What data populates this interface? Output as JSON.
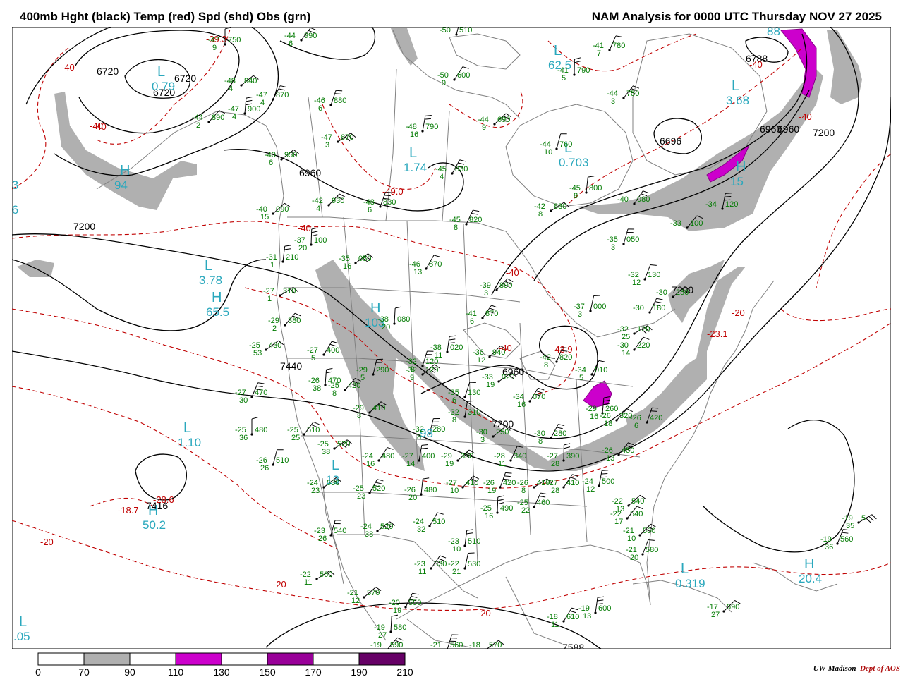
{
  "header": {
    "left_title": "400mb Hght (black) Temp (red) Spd (shd) Obs (grn)",
    "right_title": "NAM Analysis for 0000 UTC Thursday  NOV 27 2025"
  },
  "colors": {
    "height": "#000000",
    "temp": "#c00000",
    "obs": "#007a00",
    "center": "#2aa8bd",
    "border": "#808080",
    "shade_70": "#b0b0b0",
    "shade_110": "#cc00cc",
    "shade_150": "#990099",
    "shade_190": "#660066"
  },
  "colorbar": {
    "ticks": [
      "0",
      "70",
      "90",
      "110",
      "130",
      "150",
      "170",
      "190",
      "210"
    ],
    "fills": [
      "#ffffff",
      "#b0b0b0",
      "#ffffff",
      "#cc00cc",
      "#ffffff",
      "#990099",
      "#ffffff",
      "#660066"
    ]
  },
  "credit": {
    "org": "UW-Madison",
    "dept": "Dept of AOS"
  },
  "height_labels": [
    "6720",
    "6720",
    "6720",
    "6960",
    "6960",
    "6960",
    "6960",
    "7200",
    "7200",
    "7200",
    "7440",
    "7200",
    "7416",
    "6788",
    "6696",
    "7588"
  ],
  "temp_labels": [
    "-40",
    "-40",
    "-40",
    "-40",
    "-40",
    "-40",
    "-40",
    "-40",
    "-20",
    "-20",
    "-20",
    "-20",
    "-39.3",
    "-49.0",
    "-43.9",
    "-23.1",
    "-18.7",
    "-28.6"
  ],
  "centers": [
    {
      "letter": "L",
      "value": "0.79"
    },
    {
      "letter": "L",
      "value": "1.74"
    },
    {
      "letter": "L",
      "value": "62.5"
    },
    {
      "letter": "L",
      "value": "3.68"
    },
    {
      "letter": "L",
      "value": "0.703"
    },
    {
      "letter": "H",
      "value": "94"
    },
    {
      "letter": "H",
      "value": "15"
    },
    {
      "letter": "L",
      "value": "3.78"
    },
    {
      "letter": "H",
      "value": "65.5"
    },
    {
      "letter": "H",
      "value": "103"
    },
    {
      "letter": "L",
      "value": "1.10"
    },
    {
      "letter": "H",
      "value": "50.2"
    },
    {
      "letter": "L",
      "value": "13"
    },
    {
      "letter": "L",
      "value": "0.319"
    },
    {
      "letter": "H",
      "value": "20.4"
    },
    {
      "letter": "L",
      "value": ".05"
    },
    {
      "letter": "",
      "value": ".3"
    },
    {
      "letter": "",
      "value": ".6"
    },
    {
      "letter": "",
      "value": "98"
    },
    {
      "letter": "",
      "value": "88"
    }
  ],
  "obs": [
    {
      "t": "-47",
      "h": "750",
      "d": "9"
    },
    {
      "t": "-44",
      "h": "990",
      "d": "6"
    },
    {
      "t": "-50",
      "h": "510",
      "d": ""
    },
    {
      "t": "-48",
      "h": "840",
      "d": "4"
    },
    {
      "t": "-47",
      "h": "870",
      "d": "4"
    },
    {
      "t": "-47",
      "h": "900",
      "d": "4"
    },
    {
      "t": "-44",
      "h": "890",
      "d": "2"
    },
    {
      "t": "-46",
      "h": "880",
      "d": "6"
    },
    {
      "t": "-47",
      "h": "870",
      "d": "3"
    },
    {
      "t": "-50",
      "h": "600",
      "d": "9"
    },
    {
      "t": "-48",
      "h": "790",
      "d": "16"
    },
    {
      "t": "-44",
      "h": "690",
      "d": "9"
    },
    {
      "t": "-41",
      "h": "780",
      "d": "7"
    },
    {
      "t": "-41",
      "h": "790",
      "d": "5"
    },
    {
      "t": "-44",
      "h": "750",
      "d": "3"
    },
    {
      "t": "-44",
      "h": "760",
      "d": "10"
    },
    {
      "t": "-40",
      "h": "950",
      "d": "6"
    },
    {
      "t": "-45",
      "h": "830",
      "d": "4"
    },
    {
      "t": "-45",
      "h": "800",
      "d": "8"
    },
    {
      "t": "-42",
      "h": "930",
      "d": "4"
    },
    {
      "t": "-48",
      "h": "830",
      "d": "6"
    },
    {
      "t": "-42",
      "h": "830",
      "d": "8"
    },
    {
      "t": "-40",
      "h": "080",
      "d": ""
    },
    {
      "t": "-34",
      "h": "120",
      "d": ""
    },
    {
      "t": "-40",
      "h": "090",
      "d": "15"
    },
    {
      "t": "-45",
      "h": "820",
      "d": "8"
    },
    {
      "t": "-37",
      "h": "100",
      "d": "20"
    },
    {
      "t": "-33",
      "h": "100",
      "d": ""
    },
    {
      "t": "-35",
      "h": "050",
      "d": "3"
    },
    {
      "t": "-35",
      "h": "050",
      "d": "16"
    },
    {
      "t": "-46",
      "h": "870",
      "d": "13"
    },
    {
      "t": "-31",
      "h": "210",
      "d": "1"
    },
    {
      "t": "-39",
      "h": "890",
      "d": "3"
    },
    {
      "t": "-32",
      "h": "130",
      "d": "12"
    },
    {
      "t": "-27",
      "h": "310",
      "d": "1"
    },
    {
      "t": "-41",
      "h": "870",
      "d": "6"
    },
    {
      "t": "-37",
      "h": "000",
      "d": "3"
    },
    {
      "t": "-30",
      "h": "250",
      "d": ""
    },
    {
      "t": "-30",
      "h": "180",
      "d": ""
    },
    {
      "t": "-38",
      "h": "080",
      "d": "20"
    },
    {
      "t": "-29",
      "h": "380",
      "d": "2"
    },
    {
      "t": "-32",
      "h": "120",
      "d": "9"
    },
    {
      "t": "-25",
      "h": "430",
      "d": "53"
    },
    {
      "t": "-27",
      "h": "400",
      "d": "5"
    },
    {
      "t": "-38",
      "h": "020",
      "d": "11"
    },
    {
      "t": "-36",
      "h": "940",
      "d": "12"
    },
    {
      "t": "-42",
      "h": "820",
      "d": "8"
    },
    {
      "t": "-32",
      "h": "120",
      "d": "25"
    },
    {
      "t": "-30",
      "h": "220",
      "d": "14"
    },
    {
      "t": "-29",
      "h": "290",
      "d": "5"
    },
    {
      "t": "-32",
      "h": "120",
      "d": "9"
    },
    {
      "t": "-34",
      "h": "010",
      "d": "5"
    },
    {
      "t": "-26",
      "h": "470",
      "d": "38"
    },
    {
      "t": "-25",
      "h": "420",
      "d": "8"
    },
    {
      "t": "-35",
      "h": "130",
      "d": "6"
    },
    {
      "t": "-33",
      "h": "020",
      "d": "19"
    },
    {
      "t": "-34",
      "h": "070",
      "d": "16"
    },
    {
      "t": "-32",
      "h": "310",
      "d": "8"
    },
    {
      "t": "-29",
      "h": "410",
      "d": "8"
    },
    {
      "t": "-27",
      "h": "470",
      "d": "30"
    },
    {
      "t": "-25",
      "h": "480",
      "d": "36"
    },
    {
      "t": "-25",
      "h": "510",
      "d": "25"
    },
    {
      "t": "-32",
      "h": "280",
      "d": "8"
    },
    {
      "t": "-30",
      "h": "250",
      "d": "3"
    },
    {
      "t": "-30",
      "h": "280",
      "d": "8"
    },
    {
      "t": "-29",
      "h": "260",
      "d": "16"
    },
    {
      "t": "-26",
      "h": "320",
      "d": "18"
    },
    {
      "t": "-26",
      "h": "420",
      "d": "6"
    },
    {
      "t": "-25",
      "h": "520",
      "d": "38"
    },
    {
      "t": "-24",
      "h": "480",
      "d": "16"
    },
    {
      "t": "-27",
      "h": "400",
      "d": "14"
    },
    {
      "t": "-29",
      "h": "330",
      "d": "19"
    },
    {
      "t": "-28",
      "h": "340",
      "d": "11"
    },
    {
      "t": "-27",
      "h": "390",
      "d": "28"
    },
    {
      "t": "-26",
      "h": "450",
      "d": "13"
    },
    {
      "t": "-26",
      "h": "510",
      "d": "26"
    },
    {
      "t": "-24",
      "h": "530",
      "d": "23"
    },
    {
      "t": "-25",
      "h": "520",
      "d": "23"
    },
    {
      "t": "-26",
      "h": "480",
      "d": "20"
    },
    {
      "t": "-27",
      "h": "410",
      "d": "10"
    },
    {
      "t": "-26",
      "h": "420",
      "d": "19"
    },
    {
      "t": "-26",
      "h": "410",
      "d": "8"
    },
    {
      "t": "-27",
      "h": "410",
      "d": "28"
    },
    {
      "t": "-24",
      "h": "500",
      "d": "12"
    },
    {
      "t": "-22",
      "h": "540",
      "d": "13"
    },
    {
      "t": "-25",
      "h": "460",
      "d": "22"
    },
    {
      "t": "-25",
      "h": "490",
      "d": "16"
    },
    {
      "t": "-22",
      "h": "540",
      "d": "17"
    },
    {
      "t": "-23",
      "h": "540",
      "d": "26"
    },
    {
      "t": "-24",
      "h": "520",
      "d": "38"
    },
    {
      "t": "-24",
      "h": "510",
      "d": "32"
    },
    {
      "t": "-23",
      "h": "510",
      "d": "10"
    },
    {
      "t": "-21",
      "h": "560",
      "d": "10"
    },
    {
      "t": "-21",
      "h": "580",
      "d": "20"
    },
    {
      "t": "-22",
      "h": "560",
      "d": "11"
    },
    {
      "t": "-23",
      "h": "530",
      "d": "11"
    },
    {
      "t": "-22",
      "h": "530",
      "d": "21"
    },
    {
      "t": "-21",
      "h": "570",
      "d": "12"
    },
    {
      "t": "-20",
      "h": "550",
      "d": "19"
    },
    {
      "t": "-19",
      "h": "580",
      "d": "27"
    },
    {
      "t": "-19",
      "h": "590",
      "d": ""
    },
    {
      "t": "-21",
      "h": "560",
      "d": ""
    },
    {
      "t": "-18",
      "h": "570",
      "d": ""
    },
    {
      "t": "-18",
      "h": "610",
      "d": "11"
    },
    {
      "t": "-19",
      "h": "600",
      "d": "13"
    },
    {
      "t": "-17",
      "h": "590",
      "d": "27"
    },
    {
      "t": "-19",
      "h": "560",
      "d": "36"
    },
    {
      "t": "-19",
      "h": "5",
      "d": "35"
    }
  ]
}
